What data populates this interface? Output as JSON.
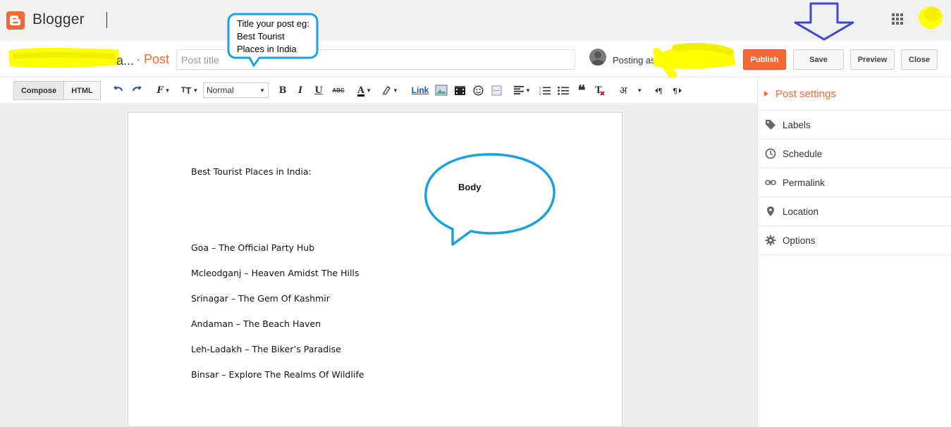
{
  "app": {
    "brand": "Blogger"
  },
  "header": {
    "blog_name_suffix": "a...",
    "crumb": "· Post",
    "title_placeholder": "Post title",
    "posting_as": "Posting as",
    "buttons": {
      "publish": "Publish",
      "save": "Save",
      "preview": "Preview",
      "close": "Close"
    }
  },
  "annotations": {
    "title_callout": "Title your post eg: Best Tourist Places in India",
    "body_callout": "Body"
  },
  "toolbar": {
    "compose": "Compose",
    "html": "HTML",
    "format_value": "Normal",
    "link": "Link",
    "hindi": "अ"
  },
  "editor": {
    "heading": "Best Tourist Places in India:",
    "lines": [
      "Goa – The Official Party Hub",
      "Mcleodganj – Heaven Amidst The Hills",
      "Srinagar – The Gem Of Kashmir",
      "Andaman – The Beach Haven",
      "Leh-Ladakh – The Biker’s Paradise",
      "Binsar – Explore The Realms Of Wildlife"
    ]
  },
  "sidebar": {
    "title": "Post settings",
    "items": [
      {
        "label": "Labels",
        "icon": "label-icon"
      },
      {
        "label": "Schedule",
        "icon": "clock-icon"
      },
      {
        "label": "Permalink",
        "icon": "link-icon"
      },
      {
        "label": "Location",
        "icon": "location-pin-icon"
      },
      {
        "label": "Options",
        "icon": "gear-icon"
      }
    ]
  },
  "colors": {
    "accent": "#f06a35",
    "callout": "#1ea0e0",
    "arrow": "#3f48cc",
    "highlight": "#ffff00"
  }
}
